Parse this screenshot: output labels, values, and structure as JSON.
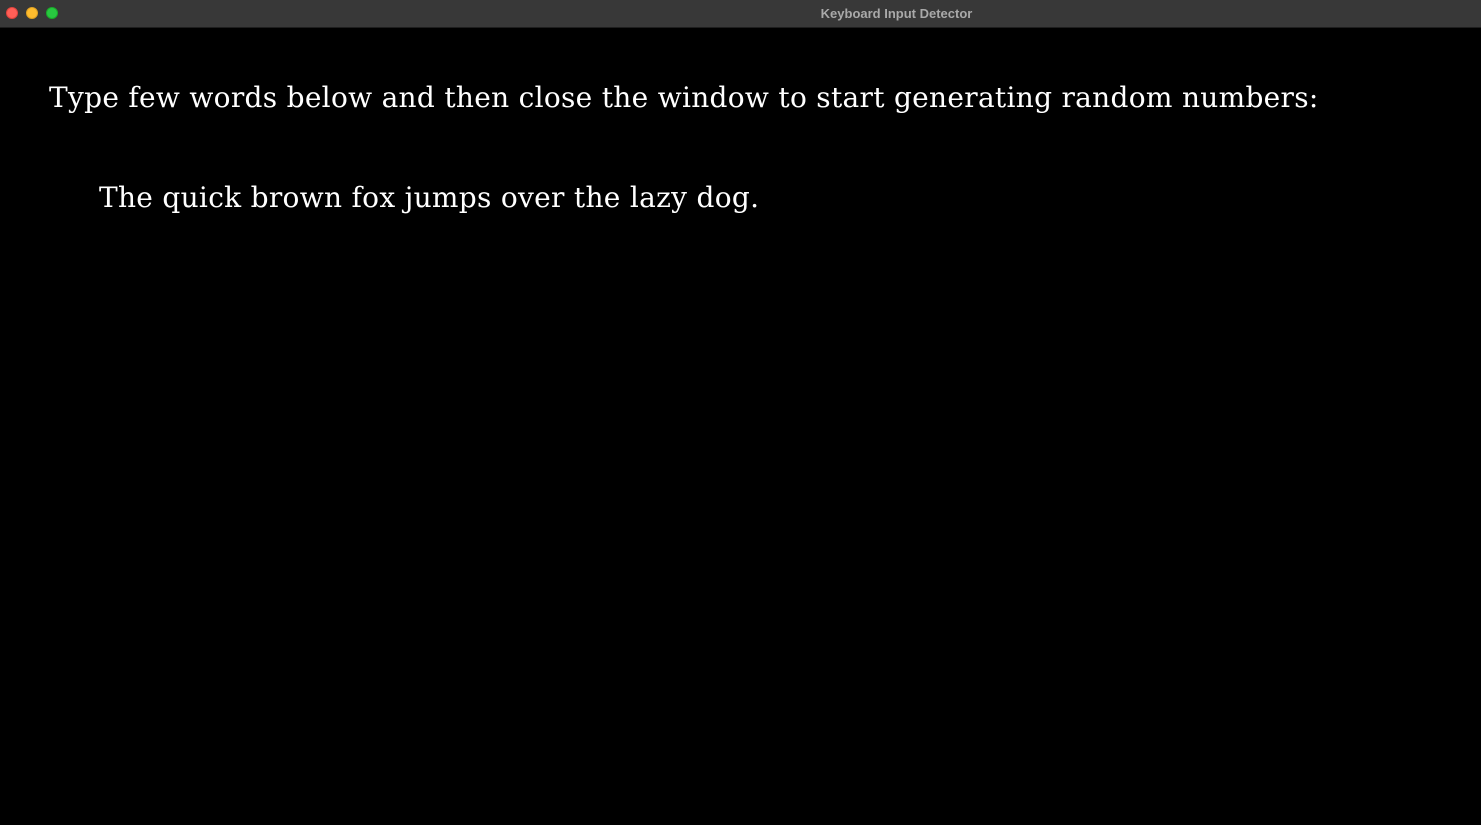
{
  "window": {
    "title": "Keyboard Input Detector",
    "controls": {
      "close_icon": "close-icon",
      "minimize_icon": "minimize-icon",
      "zoom_icon": "zoom-icon"
    }
  },
  "main": {
    "prompt": "Type few words below and then close the window to start generating random numbers:",
    "typed_text": "The quick brown fox jumps over the lazy dog."
  },
  "colors": {
    "background": "#000000",
    "text": "#ffffff",
    "titlebar": "#383838",
    "close": "#ff5f57",
    "minimize": "#febc2e",
    "zoom": "#28c840"
  }
}
